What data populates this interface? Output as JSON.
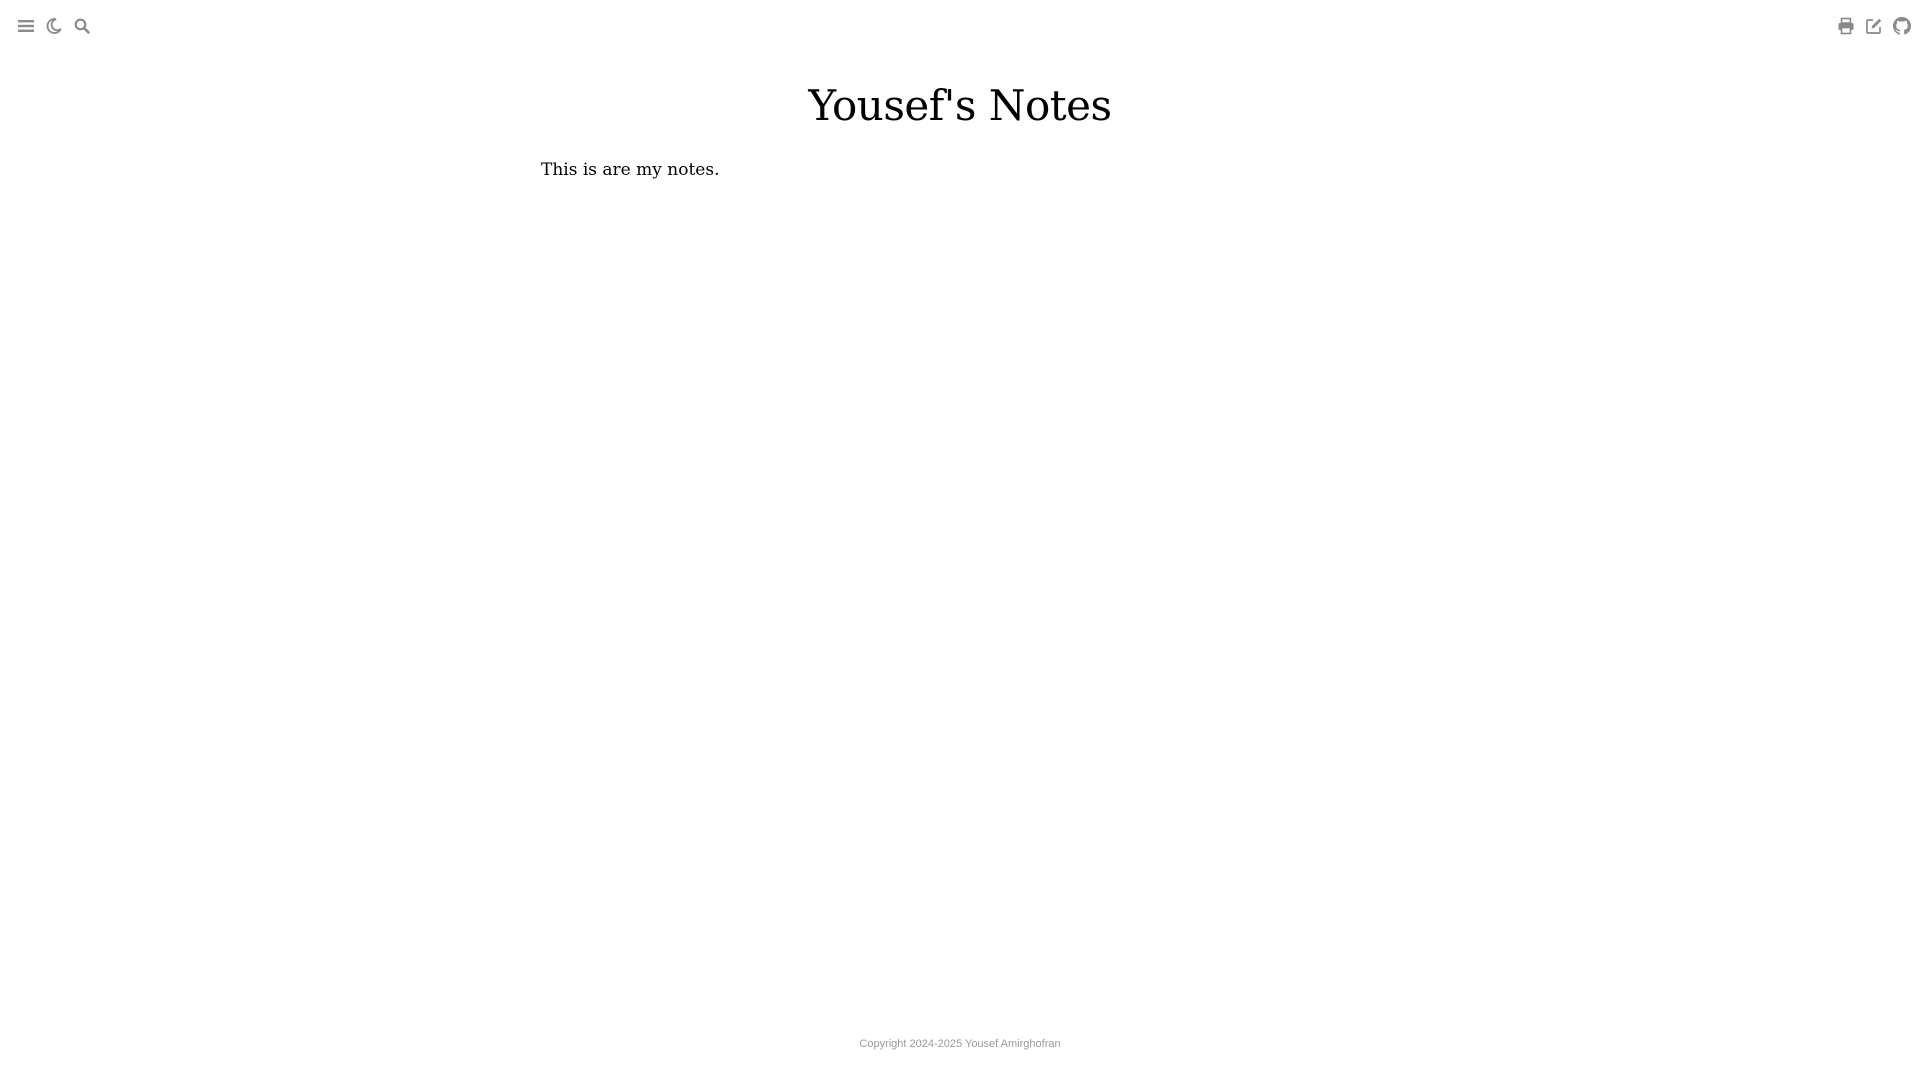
{
  "toolbar": {
    "left_icons": [
      "menu-icon",
      "moon-icon",
      "search-icon"
    ],
    "right_icons": [
      "print-icon",
      "edit-icon",
      "github-icon"
    ],
    "icon_color": "#8a8a8a"
  },
  "page": {
    "title": "Yousef's Notes",
    "intro": "This is are my notes."
  },
  "footer": {
    "copyright": "Copyright 2024-2025 Yousef Amirghofran"
  },
  "colors": {
    "background": "#ffffff",
    "text": "#000000",
    "footer_text": "#9a9a9a"
  }
}
